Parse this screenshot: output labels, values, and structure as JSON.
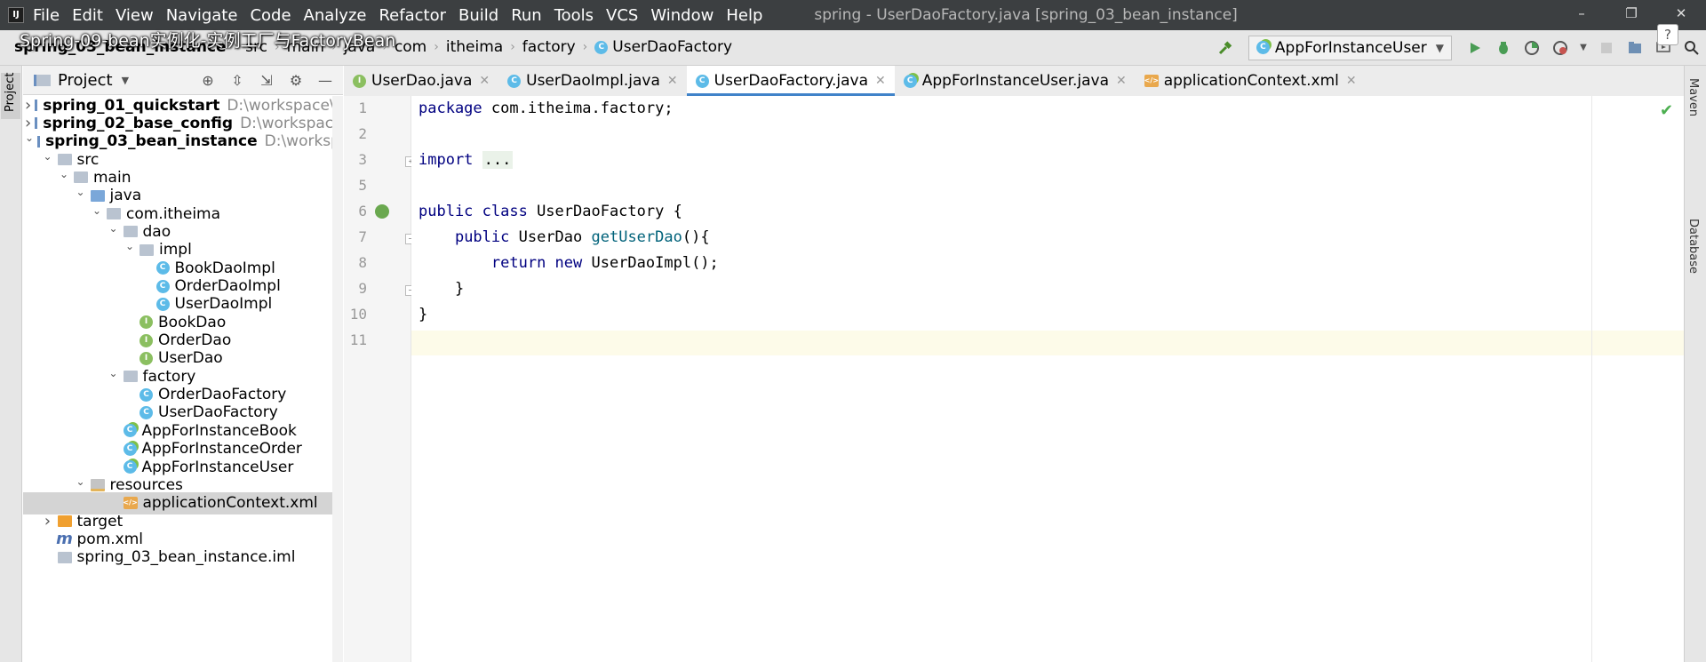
{
  "window": {
    "title": "spring - UserDaoFactory.java [spring_03_bean_instance]",
    "menu": [
      "File",
      "Edit",
      "View",
      "Navigate",
      "Code",
      "Analyze",
      "Refactor",
      "Build",
      "Run",
      "Tools",
      "VCS",
      "Window",
      "Help"
    ],
    "controls": [
      "–",
      "❐",
      "✕"
    ]
  },
  "overlay": {
    "text": "Spring-09-bean实例化-实例工厂与FactoryBean"
  },
  "breadcrumb": [
    "spring_03_bean_instance",
    "src",
    "main",
    "java",
    "com",
    "itheima",
    "factory",
    "UserDaoFactory"
  ],
  "toolbar": {
    "run_config": "AppForInstanceUser"
  },
  "left_strip": {
    "label": "Project"
  },
  "project": {
    "title": "Project",
    "tree": [
      {
        "label": "spring_01_quickstart",
        "path": "D:\\workspace\\sp",
        "icon": "module",
        "arrow": "right",
        "depth": 0,
        "bold": true
      },
      {
        "label": "spring_02_base_config",
        "path": "D:\\workspace\\s",
        "icon": "module",
        "arrow": "right",
        "depth": 0,
        "bold": true
      },
      {
        "label": "spring_03_bean_instance",
        "path": "D:\\workspace",
        "icon": "module",
        "arrow": "down",
        "depth": 0,
        "bold": true
      },
      {
        "label": "src",
        "icon": "folder",
        "arrow": "down",
        "depth": 1
      },
      {
        "label": "main",
        "icon": "folder",
        "arrow": "down",
        "depth": 2
      },
      {
        "label": "java",
        "icon": "folder-blue",
        "arrow": "down",
        "depth": 3
      },
      {
        "label": "com.itheima",
        "icon": "folder",
        "arrow": "down",
        "depth": 4
      },
      {
        "label": "dao",
        "icon": "folder",
        "arrow": "down",
        "depth": 5
      },
      {
        "label": "impl",
        "icon": "folder",
        "arrow": "down",
        "depth": 6
      },
      {
        "label": "BookDaoImpl",
        "icon": "class",
        "depth": 7
      },
      {
        "label": "OrderDaoImpl",
        "icon": "class",
        "depth": 7
      },
      {
        "label": "UserDaoImpl",
        "icon": "class",
        "depth": 7
      },
      {
        "label": "BookDao",
        "icon": "interface",
        "depth": 6
      },
      {
        "label": "OrderDao",
        "icon": "interface",
        "depth": 6
      },
      {
        "label": "UserDao",
        "icon": "interface",
        "depth": 6
      },
      {
        "label": "factory",
        "icon": "folder",
        "arrow": "down",
        "depth": 5
      },
      {
        "label": "OrderDaoFactory",
        "icon": "class",
        "depth": 6
      },
      {
        "label": "UserDaoFactory",
        "icon": "class",
        "depth": 6
      },
      {
        "label": "AppForInstanceBook",
        "icon": "main",
        "depth": 5
      },
      {
        "label": "AppForInstanceOrder",
        "icon": "main",
        "depth": 5
      },
      {
        "label": "AppForInstanceUser",
        "icon": "main",
        "depth": 5
      },
      {
        "label": "resources",
        "icon": "folder-res",
        "arrow": "down",
        "depth": 3
      },
      {
        "label": "applicationContext.xml",
        "icon": "xml",
        "depth": 5,
        "selected": true
      },
      {
        "label": "target",
        "icon": "folder-orange",
        "arrow": "right",
        "depth": 1
      },
      {
        "label": "pom.xml",
        "icon": "pom",
        "depth": 1
      },
      {
        "label": "spring_03_bean_instance.iml",
        "icon": "iml",
        "depth": 1
      }
    ]
  },
  "tabs": [
    {
      "label": "UserDao.java",
      "icon": "interface",
      "active": false
    },
    {
      "label": "UserDaoImpl.java",
      "icon": "class",
      "active": false
    },
    {
      "label": "UserDaoFactory.java",
      "icon": "class",
      "active": true
    },
    {
      "label": "AppForInstanceUser.java",
      "icon": "main",
      "active": false
    },
    {
      "label": "applicationContext.xml",
      "icon": "xml",
      "active": false
    }
  ],
  "editor": {
    "lines": [
      {
        "n": "1",
        "tokens": [
          {
            "t": "package",
            "c": "kw"
          },
          {
            "t": " com.itheima.factory;",
            "c": ""
          }
        ]
      },
      {
        "n": "2",
        "tokens": []
      },
      {
        "n": "3",
        "tokens": [
          {
            "t": "import",
            "c": "kw"
          },
          {
            "t": " ",
            "c": ""
          },
          {
            "t": "...",
            "c": "fold-import"
          }
        ]
      },
      {
        "n": "5",
        "tokens": []
      },
      {
        "n": "6",
        "tokens": [
          {
            "t": "public class",
            "c": "kw"
          },
          {
            "t": " UserDaoFactory {",
            "c": ""
          }
        ]
      },
      {
        "n": "7",
        "tokens": [
          {
            "t": "    ",
            "c": ""
          },
          {
            "t": "public",
            "c": "kw"
          },
          {
            "t": " UserDao ",
            "c": ""
          },
          {
            "t": "getUserDao",
            "c": "fn"
          },
          {
            "t": "(){",
            "c": ""
          }
        ]
      },
      {
        "n": "8",
        "tokens": [
          {
            "t": "        ",
            "c": ""
          },
          {
            "t": "return new",
            "c": "kw"
          },
          {
            "t": " UserDaoImpl();",
            "c": ""
          }
        ]
      },
      {
        "n": "9",
        "tokens": [
          {
            "t": "    }",
            "c": ""
          }
        ]
      },
      {
        "n": "10",
        "tokens": [
          {
            "t": "}",
            "c": ""
          }
        ]
      },
      {
        "n": "11",
        "tokens": []
      }
    ]
  },
  "right_strip": [
    "Maven",
    "Database"
  ]
}
